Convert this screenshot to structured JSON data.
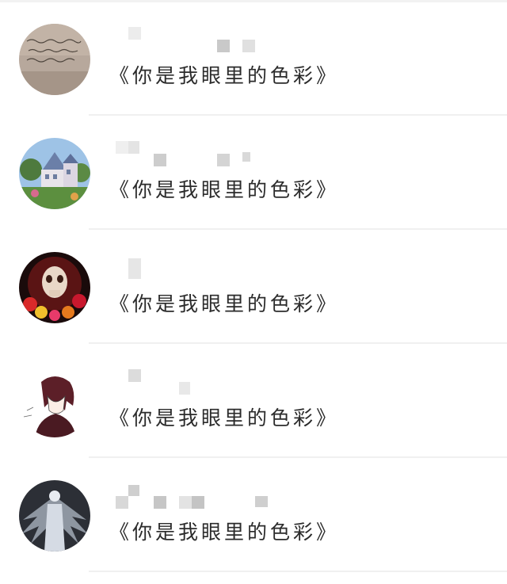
{
  "contacts": [
    {
      "avatar_icon": "handwriting-note-avatar",
      "signature": "《你是我眼里的色彩》"
    },
    {
      "avatar_icon": "victorian-house-avatar",
      "signature": "《你是我眼里的色彩》"
    },
    {
      "avatar_icon": "skull-roses-avatar",
      "signature": "《你是我眼里的色彩》"
    },
    {
      "avatar_icon": "anime-character-avatar",
      "signature": "《你是我眼里的色彩》"
    },
    {
      "avatar_icon": "winged-figure-avatar",
      "signature": "《你是我眼里的色彩》"
    }
  ]
}
